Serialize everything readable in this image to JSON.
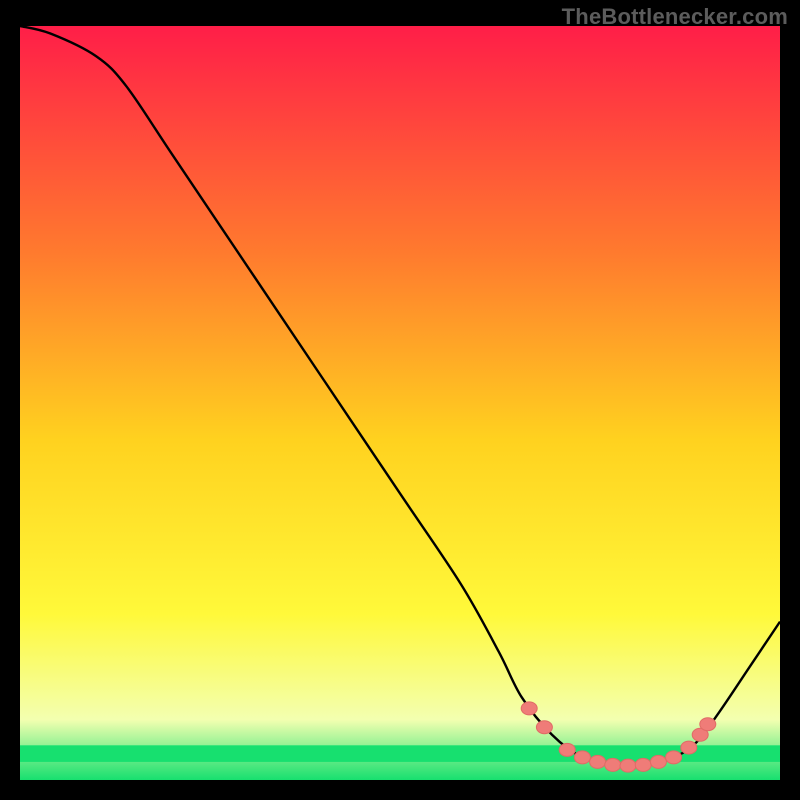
{
  "watermark": "TheBottlenecker.com",
  "colors": {
    "gradient_top": "#ff1e48",
    "gradient_mid1": "#ff7a2e",
    "gradient_mid2": "#ffd21f",
    "gradient_mid3": "#fff93a",
    "gradient_low": "#f3ffb0",
    "gradient_bottom": "#17e06f",
    "curve": "#000000",
    "marker_fill": "#ef7c78",
    "marker_stroke": "#e06b66"
  },
  "chart_data": {
    "type": "line",
    "title": "",
    "xlabel": "",
    "ylabel": "",
    "xlim": [
      0,
      100
    ],
    "ylim": [
      0,
      100
    ],
    "curve": [
      {
        "x": 0,
        "y": 100
      },
      {
        "x": 4,
        "y": 99
      },
      {
        "x": 10,
        "y": 96
      },
      {
        "x": 14,
        "y": 92
      },
      {
        "x": 20,
        "y": 83
      },
      {
        "x": 30,
        "y": 68
      },
      {
        "x": 40,
        "y": 53
      },
      {
        "x": 50,
        "y": 38
      },
      {
        "x": 58,
        "y": 26
      },
      {
        "x": 63,
        "y": 17
      },
      {
        "x": 66,
        "y": 11
      },
      {
        "x": 70,
        "y": 6
      },
      {
        "x": 74,
        "y": 3
      },
      {
        "x": 78,
        "y": 2
      },
      {
        "x": 82,
        "y": 2
      },
      {
        "x": 86,
        "y": 3
      },
      {
        "x": 89,
        "y": 5
      },
      {
        "x": 92,
        "y": 9
      },
      {
        "x": 96,
        "y": 15
      },
      {
        "x": 100,
        "y": 21
      }
    ],
    "markers": [
      {
        "x": 67,
        "y": 9.5
      },
      {
        "x": 69,
        "y": 7
      },
      {
        "x": 72,
        "y": 4
      },
      {
        "x": 74,
        "y": 3
      },
      {
        "x": 76,
        "y": 2.4
      },
      {
        "x": 78,
        "y": 2
      },
      {
        "x": 80,
        "y": 1.9
      },
      {
        "x": 82,
        "y": 2
      },
      {
        "x": 84,
        "y": 2.4
      },
      {
        "x": 86,
        "y": 3
      },
      {
        "x": 88,
        "y": 4.3
      },
      {
        "x": 89.5,
        "y": 6
      },
      {
        "x": 90.5,
        "y": 7.4
      }
    ],
    "green_band": {
      "y0": 2.4,
      "y1": 4.6
    }
  }
}
